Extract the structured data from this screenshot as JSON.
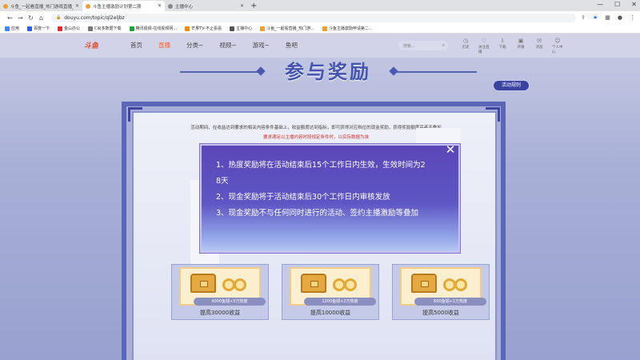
{
  "browser": {
    "tabs": [
      {
        "label": "斗鱼_一起看直播_热门游戏直播_斗鱼",
        "active": false,
        "color": "#f0a030"
      },
      {
        "label": "斗鱼主播激励计划第二期",
        "active": true,
        "color": "#f0a030"
      },
      {
        "label": "主播中心",
        "active": false,
        "color": "#888888"
      }
    ],
    "new_tab": "+",
    "window_controls": [
      "—",
      "☐",
      "✕"
    ],
    "nav": {
      "back": "←",
      "forward": "→",
      "reload": "↻",
      "home": "⌂"
    },
    "url": "douyu.com/topic/ql2eljbz",
    "lock_icon": "🔒",
    "bookmarks": [
      {
        "label": "应用",
        "color": "#4285f4"
      },
      {
        "label": "百度一下",
        "color": "#3060d8"
      },
      {
        "label": "金山办公",
        "color": "#d83030"
      },
      {
        "label": "C尚多数据下载",
        "color": "#777777"
      },
      {
        "label": "腾讯视频-在线视频网...",
        "color": "#20a040"
      },
      {
        "label": "芒果TV-不止看看",
        "color": "#ff8a00"
      },
      {
        "label": "主播中心",
        "color": "#555555"
      },
      {
        "label": "斗鱼_一起看直播_热门游...",
        "color": "#f0a030"
      },
      {
        "label": "斗鱼主播激励申请第二...",
        "color": "#f0a030"
      }
    ]
  },
  "site": {
    "logo": "斗鱼",
    "nav": [
      "首页",
      "直播",
      "分类~",
      "视频~",
      "游戏~",
      "鱼吧"
    ],
    "active_nav": "直播",
    "search_placeholder": "搜索...",
    "user_icons": [
      {
        "label": "历史",
        "icon": "history-icon"
      },
      {
        "label": "关注直播",
        "icon": "follow-icon"
      },
      {
        "label": "下载",
        "icon": "download-icon"
      },
      {
        "label": "开播",
        "icon": "broadcast-icon"
      },
      {
        "label": "消息",
        "icon": "message-icon"
      },
      {
        "label": "个人中心",
        "icon": "user-icon"
      }
    ]
  },
  "event": {
    "title": "参与奖励",
    "rules_button": "活动规则",
    "rules_text": "活动期间，在收益达到要求的相关内容条件基础上，收益额度达到指标，即可获得对应档位的现金奖励，获得奖励额度高者不叠加",
    "rules_text_red": "要求满足以主播内容时段规定条件时，以实际数据为准",
    "rewards": [
      {
        "pill": "4000鱼翅+5万热度",
        "caption": "提高30000收益"
      },
      {
        "pill": "1200鱼翅+2万热度",
        "caption": "提高10000收益"
      },
      {
        "pill": "600鱼翅+1万热度",
        "caption": "提高5000收益"
      }
    ]
  },
  "modal": {
    "lines": [
      "1、热度奖励将在活动结束后15个工作日内生效，生效时间为2",
      "8天",
      "2、现金奖励将于活动结束后30个工作日内审核发放",
      "3、现金奖励不与任何同时进行的活动、签约主播激励等叠加"
    ],
    "close": "✕"
  }
}
